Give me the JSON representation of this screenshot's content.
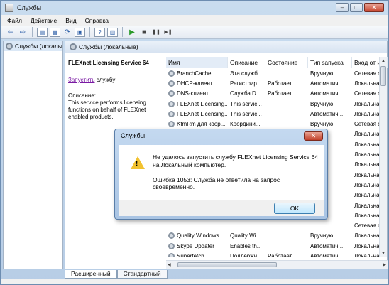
{
  "window": {
    "title": "Службы",
    "btn_min": "–",
    "btn_max": "□",
    "btn_close": "✕"
  },
  "menu": [
    "Файл",
    "Действие",
    "Вид",
    "Справка"
  ],
  "toolbar": {
    "back": "⇦",
    "forward": "⇨",
    "help": "?",
    "play": "▶",
    "stop": "■",
    "pause": "❚❚",
    "restart": "▶❚"
  },
  "tree": {
    "item": "Службы (локалы"
  },
  "pane": {
    "header": "Службы (локальные)",
    "service_name": "FLEXnet Licensing Service 64",
    "start_link": "Запустить",
    "start_suffix": " службу",
    "desc_label": "Описание:",
    "desc_text": "This service performs licensing functions on behalf of FLEXnet enabled products."
  },
  "columns": [
    "Имя",
    "Описание",
    "Состояние",
    "Тип запуска",
    "Вход от и"
  ],
  "rows": [
    [
      "BranchCache",
      "Эта служб...",
      "",
      "Вручную",
      "Сетевая с"
    ],
    [
      "DHCP-клиент",
      "Регистрир...",
      "Работает",
      "Автоматич...",
      "Локальна"
    ],
    [
      "DNS-клиент",
      "Служба D...",
      "Работает",
      "Автоматич...",
      "Сетевая с"
    ],
    [
      "FLEXnet Licensing...",
      "This servic...",
      "",
      "Вручную",
      "Локальна"
    ],
    [
      "FLEXnet Licensing...",
      "This servic...",
      "",
      "Автоматич...",
      "Локальна"
    ],
    [
      "KtmRm для коор...",
      "Координи...",
      "",
      "Вручную",
      "Сетевая с"
    ],
    [
      "",
      "",
      "",
      "",
      "Локальна"
    ],
    [
      "",
      "",
      "",
      "",
      "Локальна"
    ],
    [
      "",
      "",
      "",
      "",
      "Локальна"
    ],
    [
      "",
      "",
      "",
      "",
      "Локальна"
    ],
    [
      "",
      "",
      "",
      "",
      "Локальна"
    ],
    [
      "",
      "",
      "",
      "",
      "Локальна"
    ],
    [
      "",
      "",
      "",
      "",
      "Локальна"
    ],
    [
      "",
      "",
      "",
      "",
      "Локальна"
    ],
    [
      "",
      "",
      "",
      "",
      "Локальна"
    ],
    [
      "",
      "",
      "",
      "",
      "Сетевая с"
    ],
    [
      "Quality Windows ...",
      "Quality Wi...",
      "",
      "Вручную",
      "Локальна"
    ],
    [
      "Skype Updater",
      "Enables th...",
      "",
      "Автоматич...",
      "Локальна"
    ],
    [
      "Superfetch",
      "Поддержи...",
      "Работает",
      "Автоматич...",
      "Локальна"
    ]
  ],
  "tabs": [
    "Расширенный",
    "Стандартный"
  ],
  "dialog": {
    "title": "Службы",
    "close": "✕",
    "message": "Не удалось запустить службу FLEXnet Licensing Service 64 на Локальный компьютер.",
    "error": "Ошибка 1053: Служба не ответила на запрос своевременно.",
    "ok": "OK",
    "icon_mark": "!"
  }
}
